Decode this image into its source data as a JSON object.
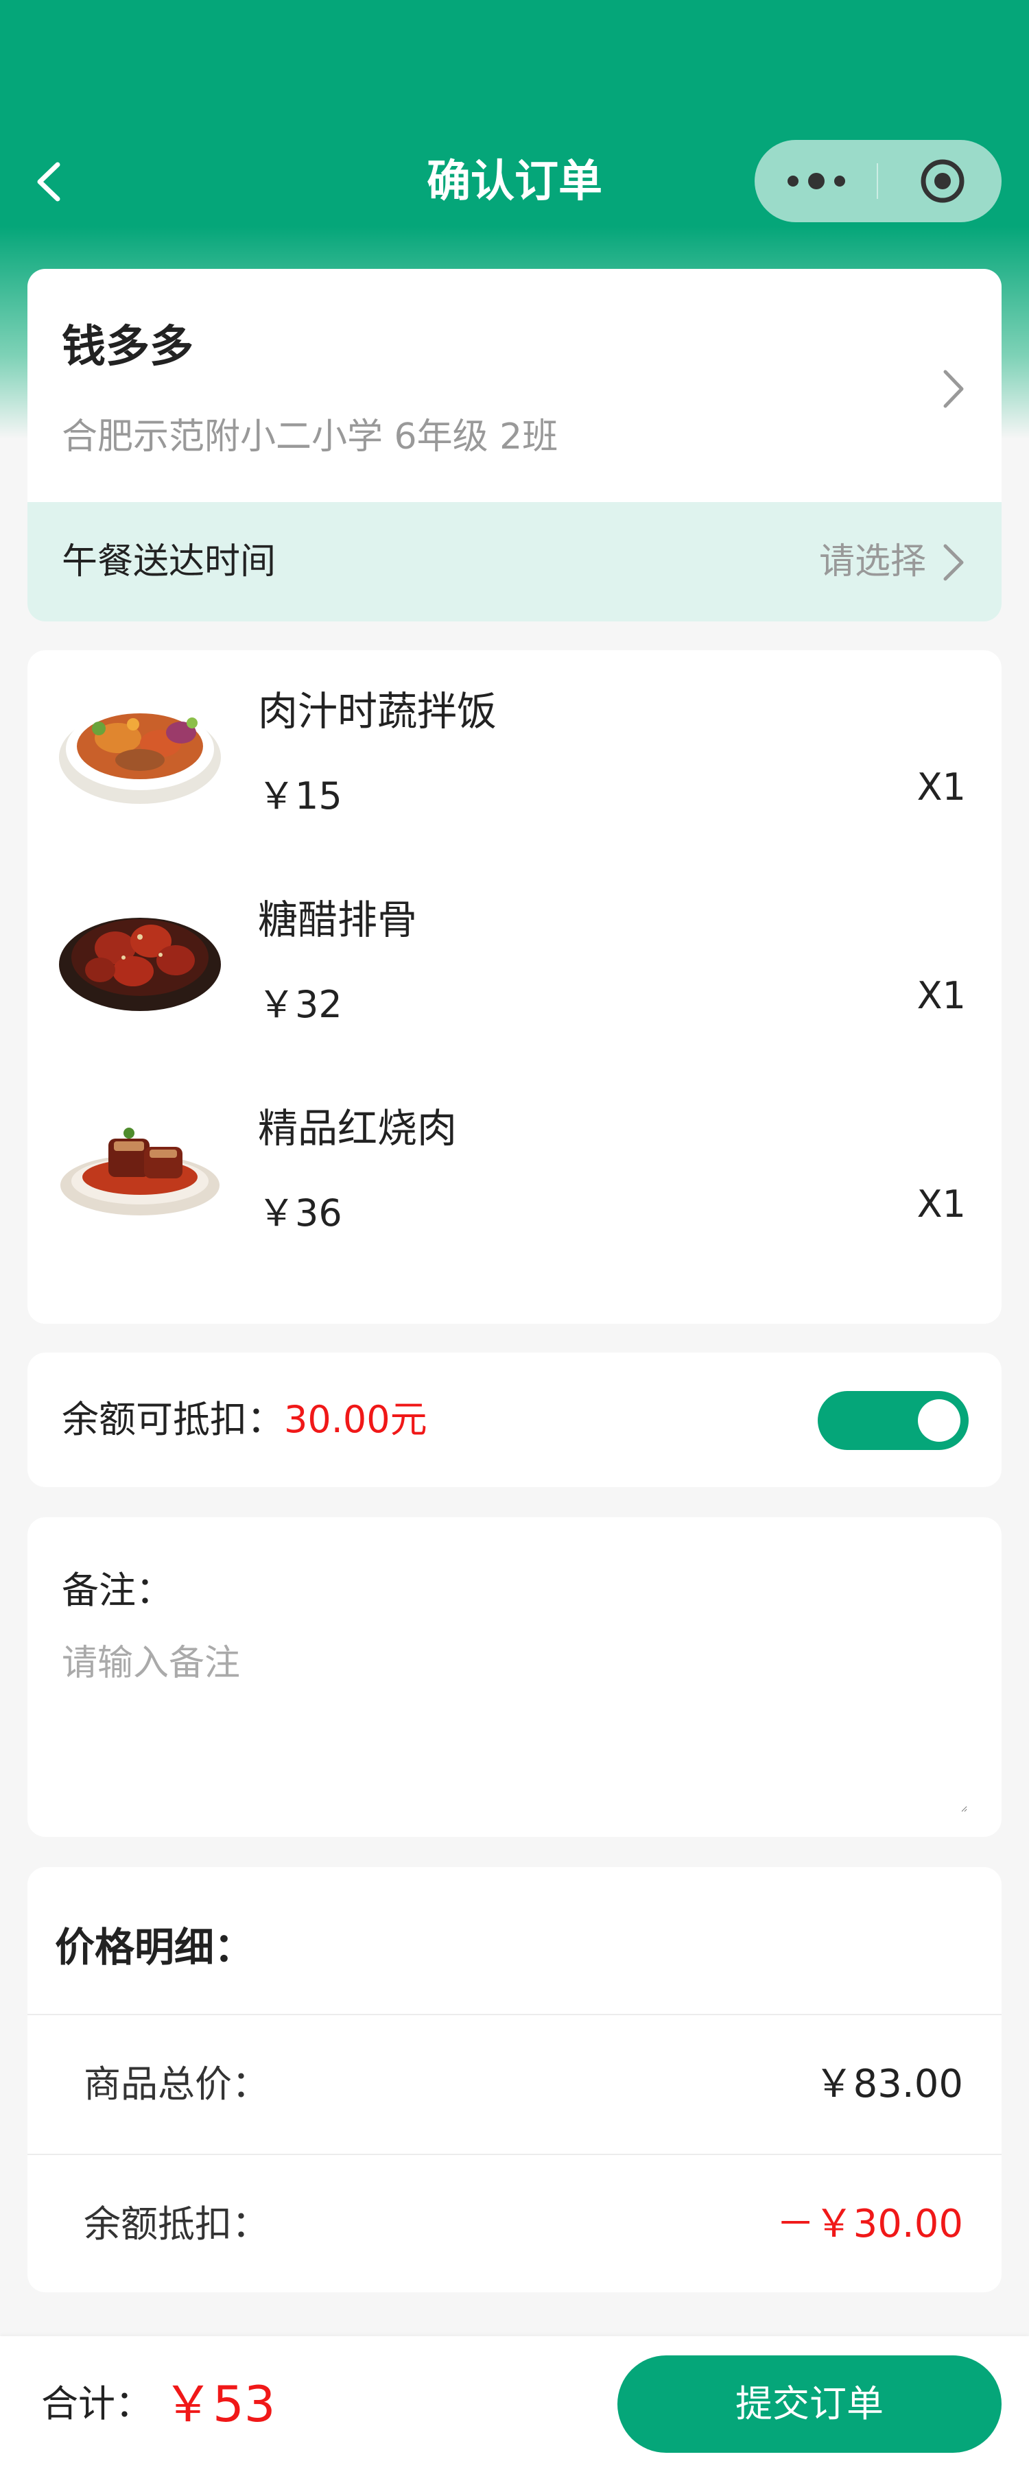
{
  "navbar": {
    "title": "确认订单",
    "back_icon": "chevron-left-icon",
    "more_icon": "more-dots-icon",
    "target_icon": "target-icon"
  },
  "address": {
    "name": "钱多多",
    "school": "合肥示范附小二小学 6年级 2班",
    "arrow_icon": "chevron-right-icon"
  },
  "delivery_time": {
    "label": "午餐送达时间",
    "value": "请选择",
    "arrow_icon": "chevron-right-icon"
  },
  "items": [
    {
      "name": "肉汁时蔬拌饭",
      "price": "￥15",
      "qty": "X1",
      "image_icon": "dish-rice-bowl-image"
    },
    {
      "name": "糖醋排骨",
      "price": "￥32",
      "qty": "X1",
      "image_icon": "dish-sweet-sour-ribs-image"
    },
    {
      "name": "精品红烧肉",
      "price": "￥36",
      "qty": "X1",
      "image_icon": "dish-braised-pork-image"
    }
  ],
  "balance": {
    "label": "余额可抵扣：",
    "amount": "30.00元",
    "toggle_on": true
  },
  "remark": {
    "label": "备注：",
    "placeholder": "请输入备注",
    "value": ""
  },
  "price_detail": {
    "title": "价格明细：",
    "rows": [
      {
        "label": "商品总价：",
        "value": "￥83.00"
      },
      {
        "label": "余额抵扣：",
        "value": "－￥30.00"
      }
    ]
  },
  "footer": {
    "total_label": "合计：",
    "total_value": "￥53",
    "submit_label": "提交订单"
  },
  "colors": {
    "brand_green": "#05a679",
    "price_red": "#f01818",
    "light_green_row": "#dff3ee"
  }
}
